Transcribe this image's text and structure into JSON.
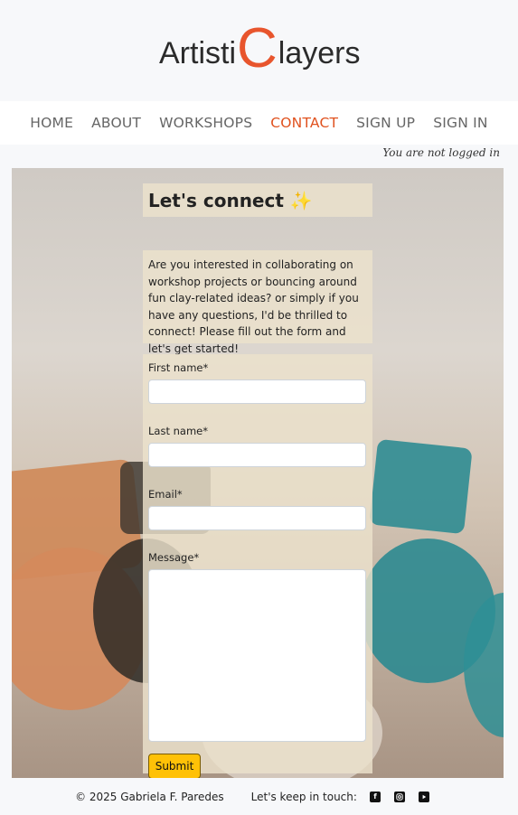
{
  "brand": {
    "part1": "Artisti",
    "big_letter": "C",
    "part2": "layers"
  },
  "nav": {
    "items": [
      {
        "label": "HOME"
      },
      {
        "label": "ABOUT"
      },
      {
        "label": "WORKSHOPS"
      },
      {
        "label": "CONTACT"
      },
      {
        "label": "SIGN UP"
      },
      {
        "label": "SIGN IN"
      }
    ]
  },
  "status": {
    "login": "You are not logged in"
  },
  "contact": {
    "title": "Let's connect ✨",
    "intro": "Are you interested in collaborating on workshop projects or bouncing around fun clay-related ideas? or simply if you have any questions, I'd be thrilled to connect! Please fill out the form and let's get started!",
    "fields": {
      "first_name": {
        "label": "First name*",
        "value": ""
      },
      "last_name": {
        "label": "Last name*",
        "value": ""
      },
      "email": {
        "label": "Email*",
        "value": ""
      },
      "message": {
        "label": "Message*",
        "value": ""
      }
    },
    "submit_label": "Submit"
  },
  "footer": {
    "copyright": "© 2025 Gabriela F. Paredes",
    "keep_in_touch": "Let's keep in touch:",
    "social_icons": [
      "facebook-icon",
      "instagram-icon",
      "youtube-icon"
    ]
  },
  "colors": {
    "accent": "#e0521f",
    "logo_accent": "#e8552d",
    "button": "#ffc107",
    "panel": "#ece2cc",
    "page_bg": "#f7f8fa"
  }
}
